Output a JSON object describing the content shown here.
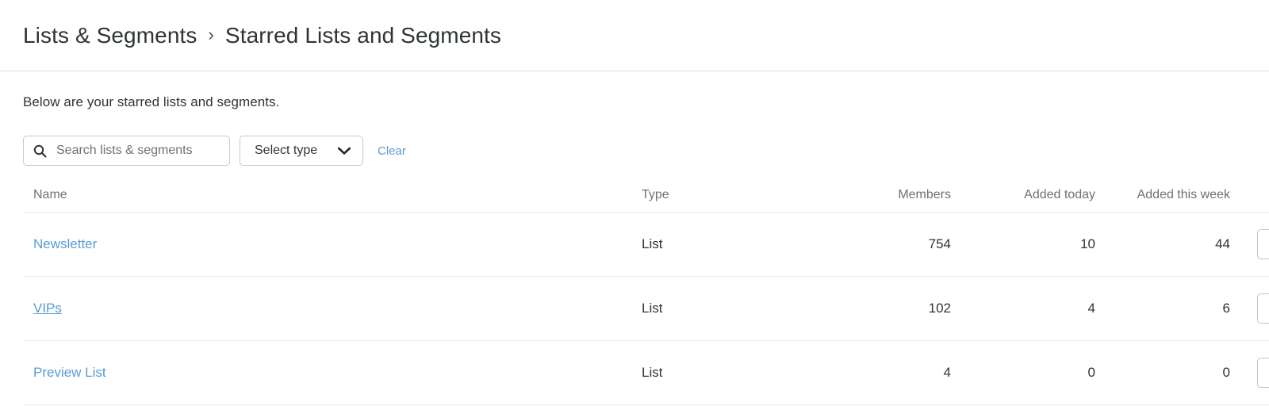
{
  "breadcrumb": {
    "items": [
      {
        "label": "Lists & Segments"
      },
      {
        "label": "Starred Lists and Segments"
      }
    ],
    "separator": "›"
  },
  "page": {
    "description": "Below are your starred lists and segments."
  },
  "filters": {
    "search": {
      "placeholder": "Search lists & segments",
      "value": "",
      "icon": "search-icon"
    },
    "type_select": {
      "label": "Select type",
      "icon": "chevron-down-icon"
    },
    "clear_label": "Clear"
  },
  "table": {
    "columns": [
      {
        "key": "name",
        "label": "Name",
        "align": "left"
      },
      {
        "key": "type",
        "label": "Type",
        "align": "left"
      },
      {
        "key": "members",
        "label": "Members",
        "align": "right"
      },
      {
        "key": "added_today",
        "label": "Added today",
        "align": "right"
      },
      {
        "key": "added_this_week",
        "label": "Added this week",
        "align": "right"
      }
    ],
    "rows": [
      {
        "name": "Newsletter",
        "type": "List",
        "members": "754",
        "added_today": "10",
        "added_this_week": "44",
        "hovered": false
      },
      {
        "name": "VIPs",
        "type": "List",
        "members": "102",
        "added_today": "4",
        "added_this_week": "6",
        "hovered": true
      },
      {
        "name": "Preview List",
        "type": "List",
        "members": "4",
        "added_today": "0",
        "added_this_week": "0",
        "hovered": false
      }
    ],
    "row_action_icon": "kebab-menu-icon"
  },
  "colors": {
    "link": "#5b9bd5",
    "text": "#2f3437",
    "muted": "#6d7175",
    "border": "#dcdcdc"
  }
}
